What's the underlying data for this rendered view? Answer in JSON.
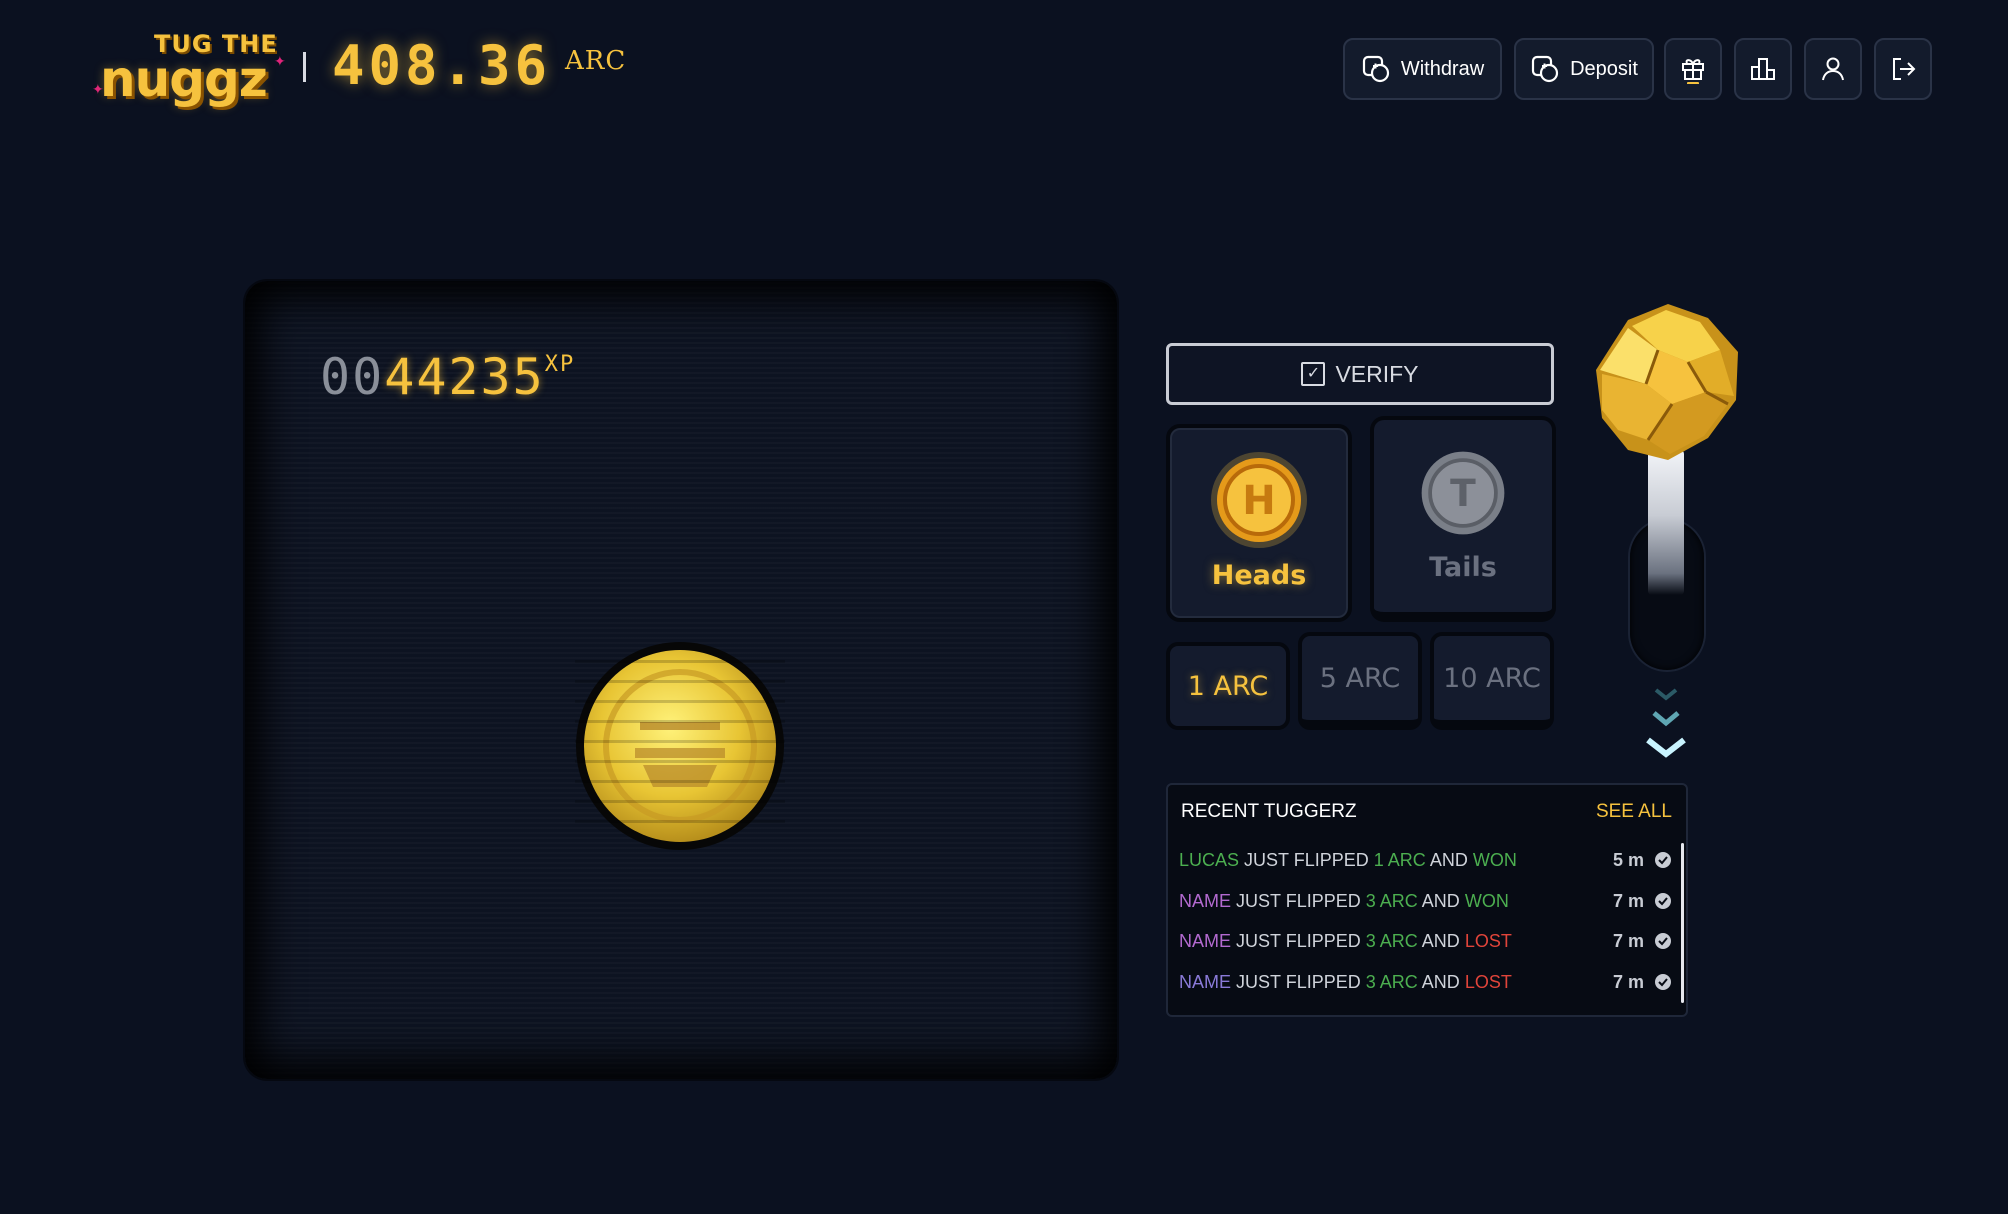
{
  "header": {
    "logo": {
      "line1": "TUG THE",
      "line2": "nuggz"
    },
    "balance": "408.36",
    "balance_unit": "ARC",
    "buttons": {
      "withdraw": "Withdraw",
      "deposit": "Deposit"
    },
    "icons": [
      "withdraw-icon",
      "deposit-icon",
      "gift-icon",
      "leaderboard-icon",
      "user-icon",
      "logout-icon"
    ]
  },
  "game": {
    "xp_dim": "00",
    "xp_lit": "44235",
    "xp_unit": "XP",
    "coin_state": "heads-side"
  },
  "controls": {
    "verify_label": "VERIFY",
    "sides": {
      "heads": {
        "label": "Heads",
        "letter": "H",
        "selected": true
      },
      "tails": {
        "label": "Tails",
        "letter": "T",
        "selected": false
      }
    },
    "amounts": [
      {
        "label": "1 ARC",
        "selected": true
      },
      {
        "label": "5 ARC",
        "selected": false
      },
      {
        "label": "10 ARC",
        "selected": false
      }
    ]
  },
  "recent": {
    "title": "RECENT TUGGERZ",
    "see_all": "SEE ALL",
    "rows": [
      {
        "name": "LUCAS",
        "mid": "JUST FLIPPED",
        "amount": "1 ARC",
        "and": "AND",
        "result": "WON",
        "time": "5 m"
      },
      {
        "name": "NAME",
        "mid": "JUST FLIPPED",
        "amount": "3 ARC",
        "and": "AND",
        "result": "WON",
        "time": "7 m"
      },
      {
        "name": "NAME",
        "mid": "JUST FLIPPED",
        "amount": "3 ARC",
        "and": "AND",
        "result": "LOST",
        "time": "7 m"
      },
      {
        "name": "NAME",
        "mid": "JUST FLIPPED",
        "amount": "3 ARC",
        "and": "AND",
        "result": "LOST",
        "time": "7 m"
      }
    ]
  },
  "colors": {
    "background": "#0b1120",
    "gold": "#f6c23e",
    "won": "#4caf50",
    "lost": "#e0443a"
  }
}
